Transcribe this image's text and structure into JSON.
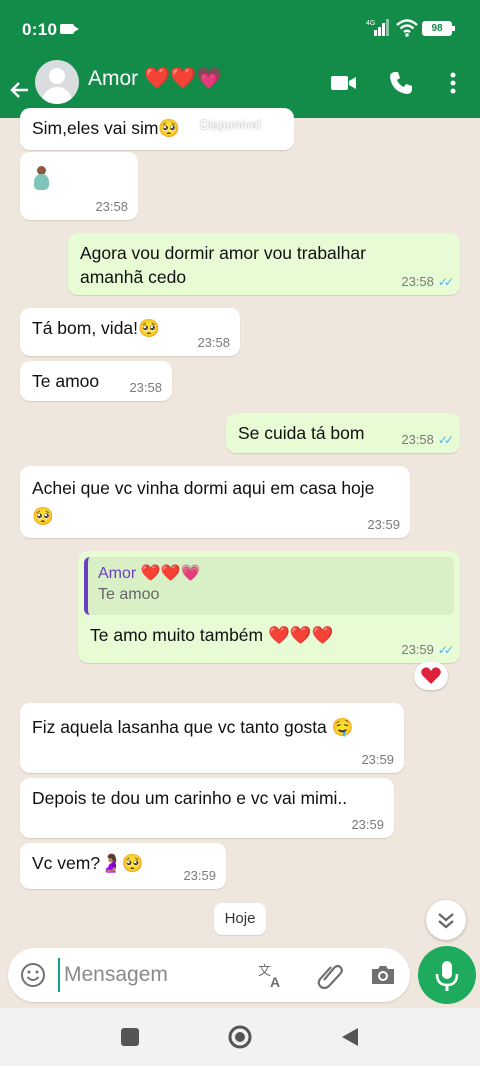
{
  "status_bar": {
    "time": "0:10",
    "battery": "98",
    "network": "4G"
  },
  "header": {
    "contact_name": "Amor ❤️❤️💗",
    "presence": "Disponível"
  },
  "messages": [
    {
      "side": "in",
      "text": "Sim,eles vai sim🥺",
      "time": ""
    },
    {
      "side": "in",
      "text": "🤰🏽",
      "time": "23:58"
    },
    {
      "side": "out",
      "text": "Agora vou dormir amor vou trabalhar amanhã cedo",
      "time": "23:58"
    },
    {
      "side": "in",
      "text": "Tá bom, vida!🥺",
      "time": "23:58"
    },
    {
      "side": "in",
      "text": "Te amoo",
      "time": "23:58"
    },
    {
      "side": "out",
      "text": "Se cuida tá bom",
      "time": "23:58"
    },
    {
      "side": "in",
      "text": "Achei que vc vinha dormi aqui em casa hoje 🥺",
      "time": "23:59"
    },
    {
      "side": "out",
      "quoted_name": "Amor ❤️❤️💗",
      "quoted_text": "Te amoo",
      "text": "Te amo muito também ❤️❤️❤️",
      "time": "23:59",
      "reaction": "❤️"
    },
    {
      "side": "in",
      "text": "Fiz aquela lasanha que vc tanto gosta 🤤",
      "time": "23:59"
    },
    {
      "side": "in",
      "text": "Depois te dou um carinho e vc vai mimi..",
      "time": "23:59"
    },
    {
      "side": "in",
      "text": "Vc vem?🤰🏽🥺",
      "time": "23:59"
    }
  ],
  "date_chip": "Hoje",
  "composer": {
    "placeholder": "Mensagem"
  },
  "colors": {
    "header": "#128c48",
    "incoming": "#ffffff",
    "outgoing": "#e7fbd5",
    "mic": "#1eab5e",
    "ticks": "#4fb6ec"
  },
  "icons": [
    "back-arrow-icon",
    "video-call-icon",
    "phone-icon",
    "more-vert-icon",
    "emoji-icon",
    "translate-icon",
    "attach-icon",
    "camera-icon",
    "mic-icon",
    "scroll-down-icon",
    "nav-square-icon",
    "nav-circle-icon",
    "nav-back-icon"
  ]
}
